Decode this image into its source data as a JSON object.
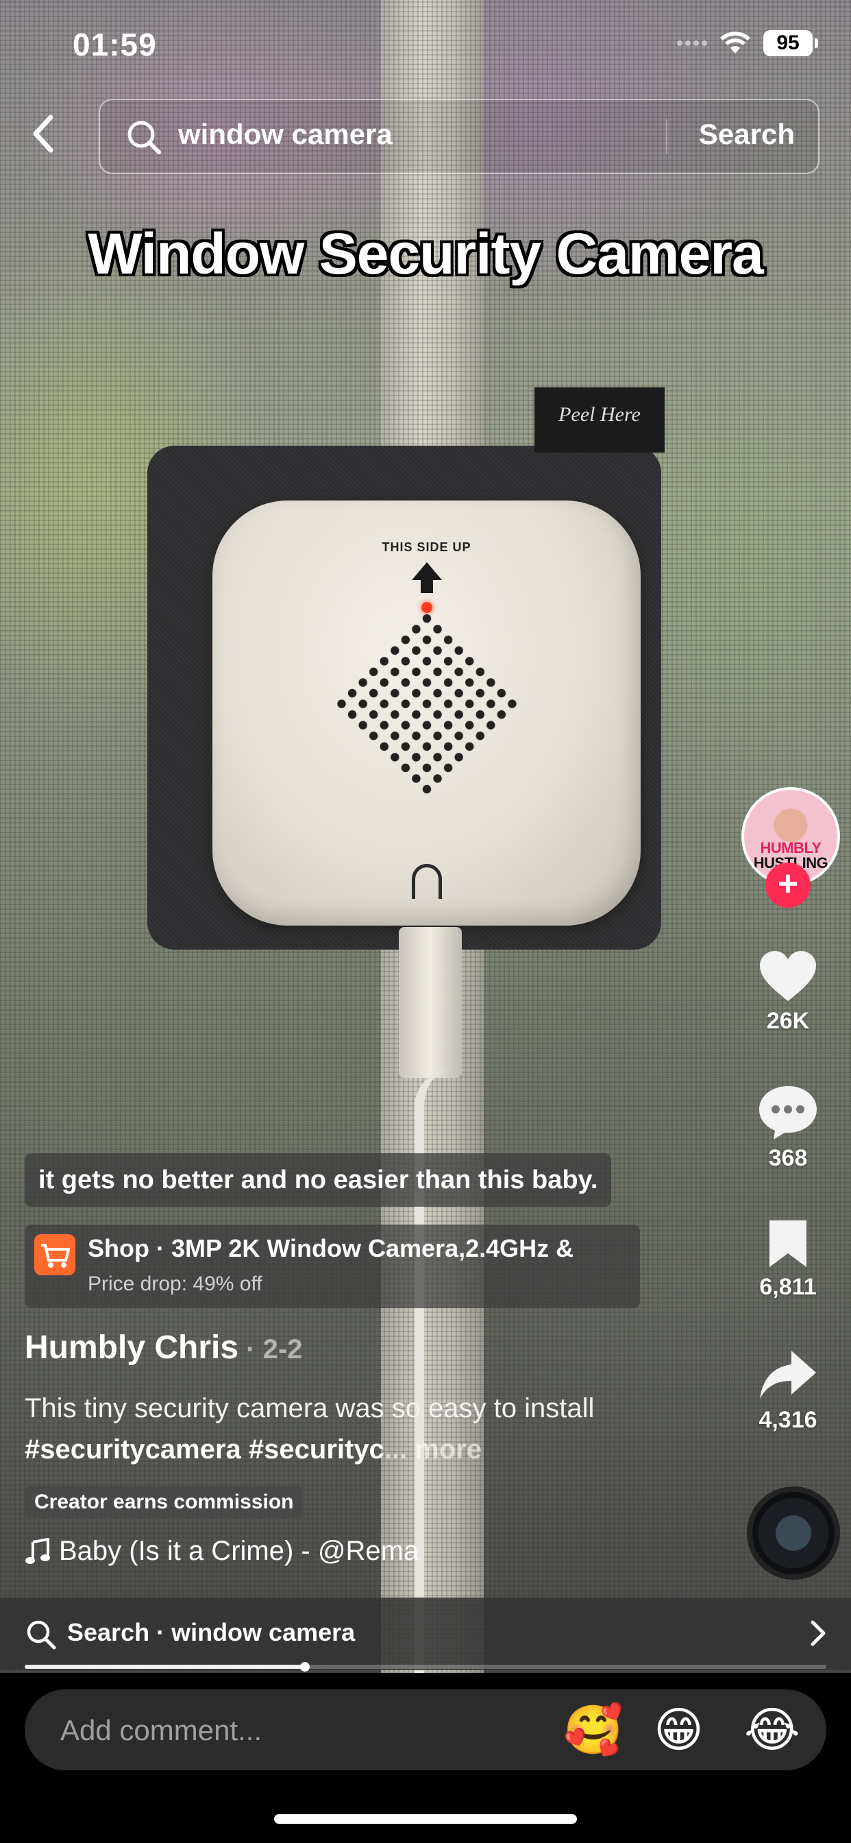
{
  "status_bar": {
    "time": "01:59",
    "battery": "95"
  },
  "search": {
    "query": "window camera",
    "submit_label": "Search"
  },
  "video": {
    "caption": "Window Security Camera",
    "peel_tab_text": "Peel Here",
    "device_label": "THIS SIDE UP"
  },
  "creator_avatar": {
    "line1": "HUMBLY",
    "line2": "HUSTLING"
  },
  "actions": {
    "likes": "26K",
    "comments": "368",
    "saves": "6,811",
    "shares": "4,316"
  },
  "post": {
    "subtitle": "it gets no better and no easier than this baby.",
    "shop": {
      "title": "Shop · 3MP 2K Window Camera,2.4GHz &",
      "subtitle": "Price drop: 49% off"
    },
    "author": "Humbly Chris",
    "date": " · 2-2",
    "description_text": "This tiny security camera was so easy to install ",
    "description_tags": "#securitycamera #securityc",
    "description_more": "... more",
    "badge": "Creator earns commission",
    "music": "Baby (Is it a Crime) - @Rema"
  },
  "suggestion": {
    "text": "Search · window camera"
  },
  "playback": {
    "progress": 0.35
  },
  "comment": {
    "placeholder": "Add comment...",
    "emojis": [
      "🥰",
      "😁",
      "😂"
    ]
  },
  "colors": {
    "accent": "#fe2c55",
    "shop": "#fe6b2c"
  }
}
